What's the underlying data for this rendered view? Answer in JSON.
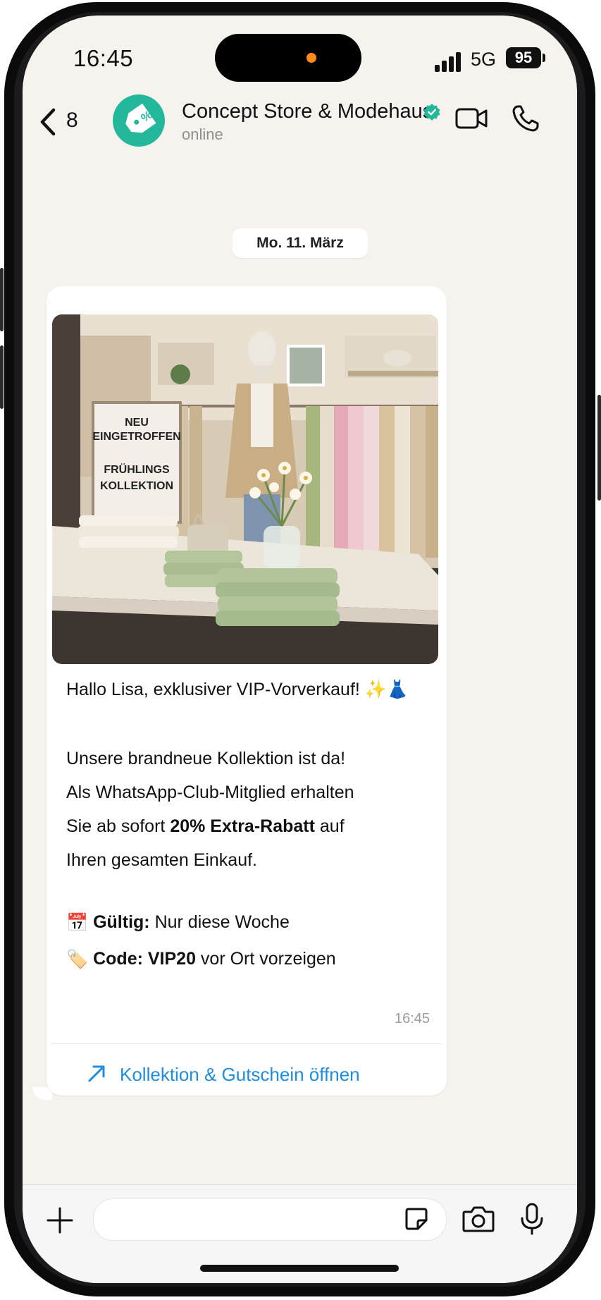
{
  "status_bar": {
    "time": "16:45",
    "network": "5G",
    "battery": "95"
  },
  "header": {
    "back_count": "8",
    "contact_name": "Concept Store & Modehaus",
    "contact_status": "online"
  },
  "chat": {
    "date_label": "Mo. 11. März",
    "image": {
      "sign_lines": [
        "NEU",
        "EINGETROFFEN",
        "FRÜHLINGS",
        "KOLLEKTION"
      ]
    },
    "message": {
      "greeting": "Hallo Lisa, exklusiver VIP-Vorverkauf! ✨👗",
      "line1": "Unsere brandneue Kollektion ist da!",
      "line2": "Als WhatsApp-Club-Mitglied erhalten",
      "line3_pre": "Sie ab sofort ",
      "line3_bold": "20% Extra-Rabatt",
      "line3_post": " auf",
      "line4": "Ihren gesamten Einkauf.",
      "valid_icon": "📅",
      "valid_label": "Gültig:",
      "valid_value": " Nur diese Woche",
      "code_icon": "🏷️",
      "code_label": "Code: VIP20",
      "code_value": " vor Ort vorzeigen",
      "time": "16:45"
    },
    "cta": {
      "label": "Kollektion & Gutschein öffnen",
      "icon": "arrow-up-right-icon"
    }
  },
  "input_bar": {
    "placeholder": "",
    "icons": [
      "plus-icon",
      "sticker-icon",
      "camera-icon",
      "mic-icon"
    ]
  },
  "colors": {
    "accent": "#23b89b",
    "link": "#1f8ee0",
    "background": "#f6f3ef"
  }
}
